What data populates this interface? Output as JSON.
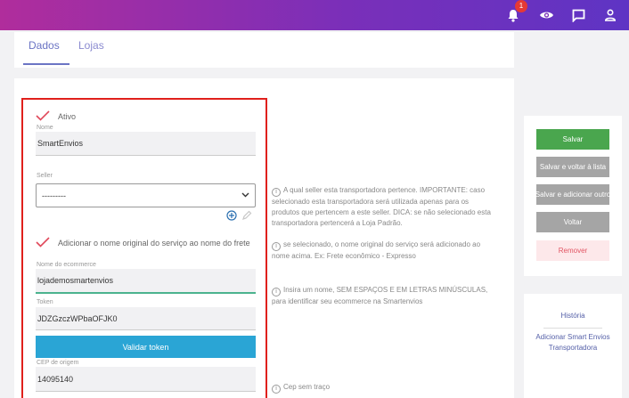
{
  "topbar": {
    "notification_count": "1",
    "icons": [
      "bell-icon",
      "eye-icon",
      "chat-icon",
      "user-icon"
    ]
  },
  "tabs": [
    {
      "label": "Dados",
      "active": true
    },
    {
      "label": "Lojas",
      "active": false
    }
  ],
  "form": {
    "ativo_label": "Ativo",
    "nome_label": "Nome",
    "nome_value": "SmartEnvios",
    "seller_label": "Seller",
    "seller_value": "---------",
    "adicionar_nome_label": "Adicionar o nome original do serviço ao nome do frete",
    "ecommerce_label": "Nome do ecommerce",
    "ecommerce_value": "lojademosmartenvios",
    "token_label": "Token",
    "token_value": "JDZGzczWPbaOFJK0",
    "validar_label": "Validar token",
    "cep_label": "CEP de origem",
    "cep_value": "14095140"
  },
  "help": {
    "seller": "A qual seller esta transportadora pertence. IMPORTANTE: caso selecionado esta transportadora será utilizada apenas para os produtos que pertencem a este seller. DICA: se não selecionado esta transportadora pertencerá a Loja Padrão.",
    "nome_original": "se selecionado, o nome original do serviço será adicionado ao nome acima. Ex: Frete econômico - Expresso",
    "ecommerce": "Insira um nome, SEM ESPAÇOS E EM LETRAS MINÚSCULAS, para identificar seu ecommerce na Smartenvios",
    "cep": "Cep sem traço"
  },
  "actions": {
    "salvar": "Salvar",
    "salvar_voltar": "Salvar e voltar à lista",
    "salvar_adicionar": "Salvar e adicionar outro",
    "voltar": "Voltar",
    "remover": "Remover"
  },
  "links": {
    "historia": "História",
    "adicionar": "Adicionar Smart Envios Transportadora"
  },
  "colors": {
    "accent": "#6b74c4",
    "highlight_border": "#e0201c",
    "primary_button": "#2aa5d5",
    "save_button": "#4aa64e",
    "checkmark": "#e0485a"
  }
}
